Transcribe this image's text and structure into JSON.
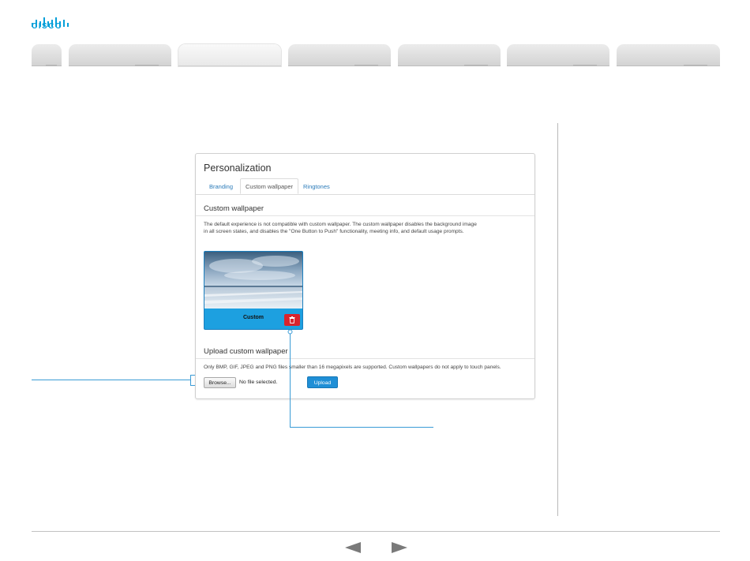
{
  "brand": {
    "logo_text": "CISCO",
    "accent": "#049fd9"
  },
  "nav": {
    "tabs": [
      "",
      "",
      "",
      "",
      "",
      "",
      ""
    ],
    "active_index": 2
  },
  "panel": {
    "title": "Personalization",
    "tabs": [
      "Branding",
      "Custom wallpaper",
      "Ringtones"
    ],
    "active_tab": "Custom wallpaper",
    "custom_wallpaper": {
      "heading": "Custom wallpaper",
      "description_line1": "The default experience is not compatible with custom wallpaper. The custom wallpaper disables the background image",
      "description_line2": "in all screen states, and disables the \"One Button to Push\" functionality, meeting info, and default usage prompts.",
      "thumbnail_label": "Custom",
      "delete_icon": "trash-icon",
      "delete_color": "#d9232d"
    },
    "upload": {
      "heading": "Upload custom wallpaper",
      "description": "Only BMP, GIF, JPEG and PNG files smaller than 16 megapixels are supported. Custom wallpapers do not apply to touch panels.",
      "browse_label": "Browse...",
      "file_status": "No file selected.",
      "upload_label": "Upload",
      "upload_color": "#1f8fd6"
    }
  },
  "footer": {
    "prev_icon": "triangle-left-icon",
    "next_icon": "triangle-right-icon"
  }
}
